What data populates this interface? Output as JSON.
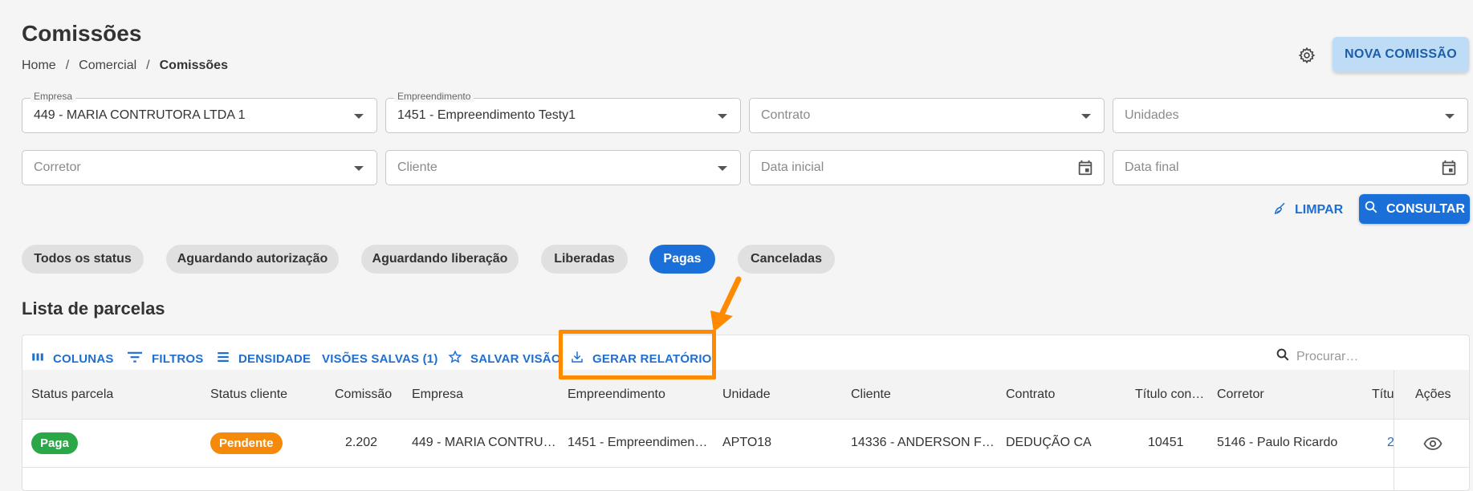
{
  "header": {
    "title": "Comissões",
    "breadcrumb": [
      "Home",
      "Comercial",
      "Comissões"
    ],
    "breadcrumb_sep": "/",
    "new_button": "NOVA COMISSÃO"
  },
  "filters": {
    "empresa": {
      "label": "Empresa",
      "value": "449 - MARIA CONTRUTORA LTDA 1"
    },
    "empreendimento": {
      "label": "Empreendimento",
      "value": "1451 - Empreendimento Testy1"
    },
    "contrato": {
      "placeholder": "Contrato"
    },
    "unidades": {
      "placeholder": "Unidades"
    },
    "corretor": {
      "placeholder": "Corretor"
    },
    "cliente": {
      "placeholder": "Cliente"
    },
    "data_inicial": {
      "placeholder": "Data inicial"
    },
    "data_final": {
      "placeholder": "Data final"
    },
    "clear_label": "LIMPAR",
    "search_label": "CONSULTAR"
  },
  "status_chips": [
    {
      "label": "Todos os status",
      "active": false
    },
    {
      "label": "Aguardando autorização",
      "active": false
    },
    {
      "label": "Aguardando liberação",
      "active": false
    },
    {
      "label": "Liberadas",
      "active": false
    },
    {
      "label": "Pagas",
      "active": true
    },
    {
      "label": "Canceladas",
      "active": false
    }
  ],
  "list": {
    "title": "Lista de parcelas",
    "toolbar": {
      "columns": "COLUNAS",
      "filters": "FILTROS",
      "density": "DENSIDADE",
      "saved_views": "VISÕES SALVAS (1)",
      "save_view": "SALVAR VISÃO",
      "report": "GERAR RELATÓRIO",
      "search_placeholder": "Procurar…"
    },
    "columns": [
      "Status parcela",
      "Status cliente",
      "Comissão",
      "Empresa",
      "Empreendimento",
      "Unidade",
      "Cliente",
      "Contrato",
      "Título con…",
      "Corretor",
      "Títu",
      "Ações"
    ],
    "rows": [
      {
        "status_parcela": "Paga",
        "status_cliente": "Pendente",
        "comissao": "2.202",
        "empresa": "449 - MARIA CONTRU…",
        "empreendimento": "1451 - Empreendimen…",
        "unidade": "APTO18",
        "cliente": "14336 - ANDERSON F…",
        "contrato": "DEDUÇÃO CA",
        "titulo_con": "10451",
        "corretor": "5146 - Paulo Ricardo",
        "titulo": "2"
      }
    ]
  },
  "colors": {
    "primary": "#1a6fd8",
    "highlight": "#ff8a00",
    "paga": "#2aa847",
    "pendente": "#f5890a"
  }
}
